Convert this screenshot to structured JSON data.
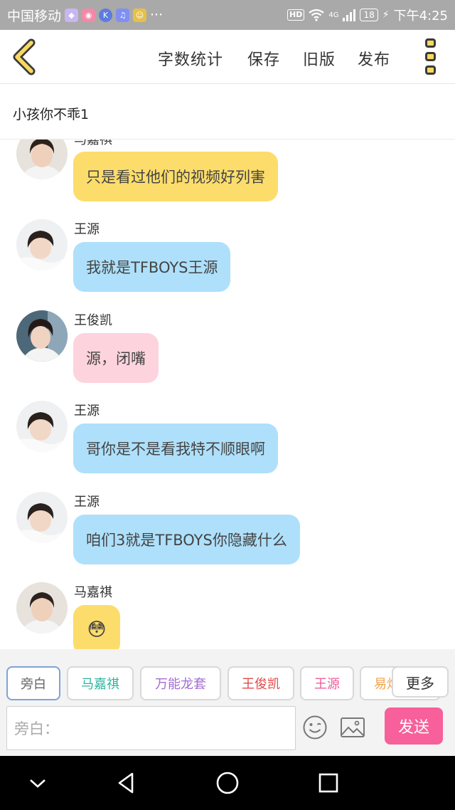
{
  "status_bar": {
    "carrier": "中国移动",
    "dots": "···",
    "hd": "HD",
    "network": "4G",
    "battery": "18",
    "time": "下午4:25"
  },
  "header": {
    "actions": [
      "字数统计",
      "保存",
      "旧版",
      "发布"
    ]
  },
  "story": {
    "title": "小孩你不乖1"
  },
  "messages": [
    {
      "sender": "马嘉祺",
      "text": "只是看过他们的视频好列害",
      "color": "#fcdd6b"
    },
    {
      "sender": "王源",
      "text": "我就是TFBOYS王源",
      "color": "#aee0fb"
    },
    {
      "sender": "王俊凯",
      "text": "源，闭嘴",
      "color": "#fdd3de"
    },
    {
      "sender": "王源",
      "text": "哥你是不是看我特不顺眼啊",
      "color": "#aee0fb"
    },
    {
      "sender": "王源",
      "text": "咱们3就是TFBOYS你隐藏什么",
      "color": "#aee0fb"
    },
    {
      "sender": "马嘉祺",
      "text": "😳",
      "color": "#fcdd6b"
    }
  ],
  "characters": [
    {
      "name": "旁白",
      "color": "#666666"
    },
    {
      "name": "马嘉祺",
      "color": "#2bb5a0"
    },
    {
      "name": "万能龙套",
      "color": "#a36cd3"
    },
    {
      "name": "王俊凯",
      "color": "#e04a4a"
    },
    {
      "name": "王源",
      "color": "#ef5d9a"
    },
    {
      "name": "易烊千玺",
      "color": "#f0a24a"
    }
  ],
  "more_label": "更多",
  "composer": {
    "placeholder": "旁白：",
    "send_label": "发送"
  }
}
